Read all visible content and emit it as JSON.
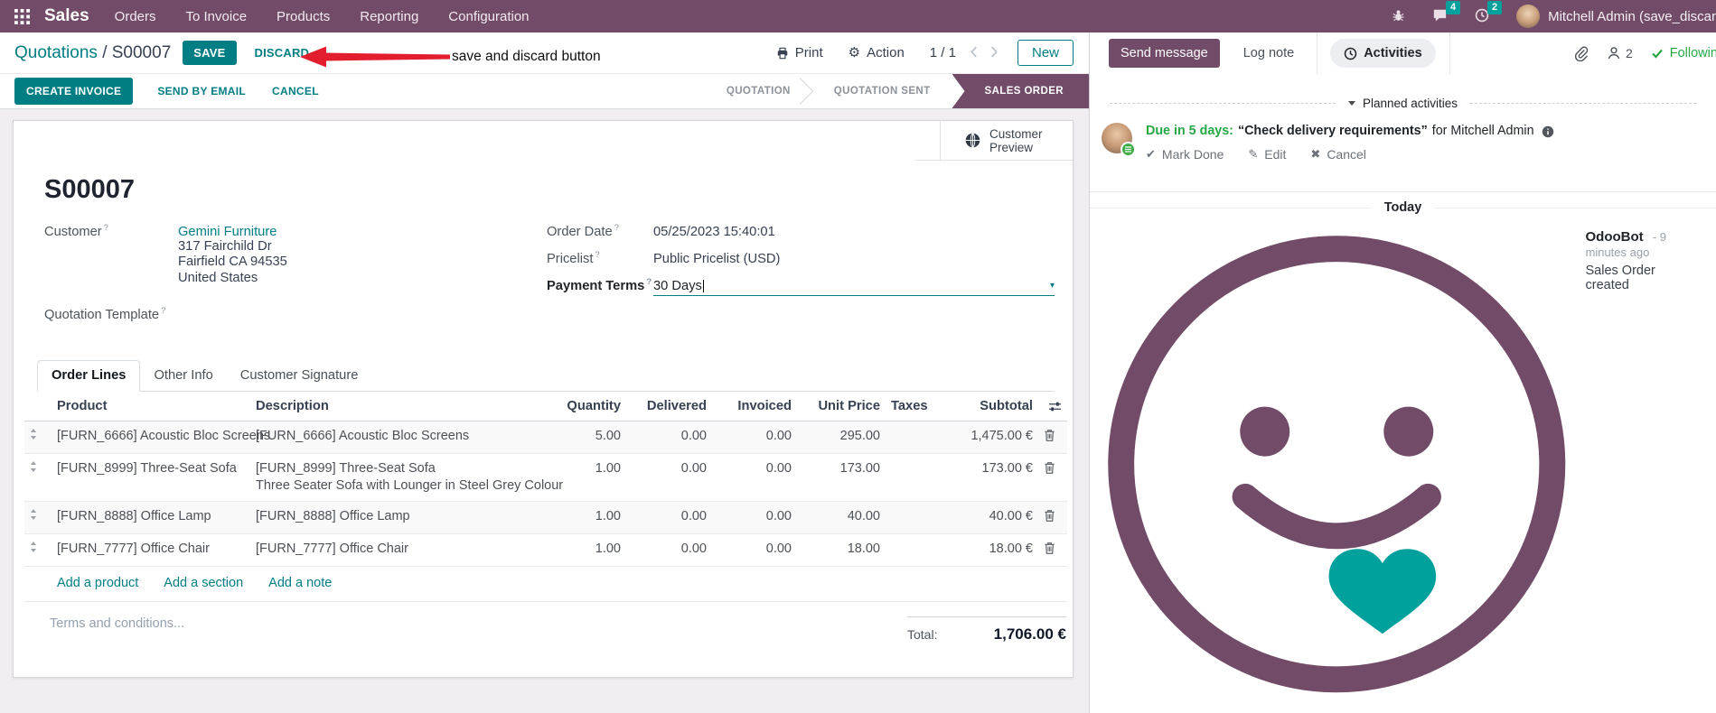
{
  "help_marker": "?",
  "topbar": {
    "app_name": "Sales",
    "menus": [
      "Orders",
      "To Invoice",
      "Products",
      "Reporting",
      "Configuration"
    ],
    "messages_badge": "4",
    "activities_badge": "2",
    "user_name": "Mitchell Admin (save_discar"
  },
  "annotation": {
    "text": "save and discard button"
  },
  "control_panel": {
    "breadcrumb_parent": "Quotations",
    "breadcrumb_separator": "/",
    "breadcrumb_current": "S00007",
    "save": "SAVE",
    "discard": "DISCARD",
    "print": "Print",
    "action": "Action",
    "pager": "1 / 1",
    "new": "New"
  },
  "status_row": {
    "create_invoice": "CREATE INVOICE",
    "send_by_email": "SEND BY EMAIL",
    "cancel": "CANCEL",
    "statuses": [
      {
        "label": "QUOTATION"
      },
      {
        "label": "QUOTATION SENT"
      },
      {
        "label": "SALES ORDER"
      }
    ]
  },
  "sheet": {
    "customer_preview": "Customer Preview",
    "title": "S00007",
    "customer_label": "Customer",
    "customer_value": "Gemini Furniture",
    "address": [
      "317 Fairchild Dr",
      "Fairfield CA 94535",
      "United States"
    ],
    "quotation_template_label": "Quotation Template",
    "order_date_label": "Order Date",
    "order_date_value": "05/25/2023 15:40:01",
    "pricelist_label": "Pricelist",
    "pricelist_value": "Public Pricelist (USD)",
    "payment_terms_label": "Payment Terms",
    "payment_terms_value": "30 Days",
    "tabs": [
      "Order Lines",
      "Other Info",
      "Customer Signature"
    ],
    "table": {
      "headers": {
        "product": "Product",
        "description": "Description",
        "quantity": "Quantity",
        "delivered": "Delivered",
        "invoiced": "Invoiced",
        "unit_price": "Unit Price",
        "taxes": "Taxes",
        "subtotal": "Subtotal"
      },
      "rows": [
        {
          "product": "[FURN_6666] Acoustic Bloc Screens",
          "desc1": "[FURN_6666] Acoustic Bloc Screens",
          "quantity": "5.00",
          "delivered": "0.00",
          "invoiced": "0.00",
          "unit_price": "295.00",
          "taxes": "",
          "subtotal": "1,475.00 €"
        },
        {
          "product": "[FURN_8999] Three-Seat Sofa",
          "desc1": "[FURN_8999] Three-Seat Sofa",
          "desc2": "Three Seater Sofa with Lounger in Steel Grey Colour",
          "quantity": "1.00",
          "delivered": "0.00",
          "invoiced": "0.00",
          "unit_price": "173.00",
          "taxes": "",
          "subtotal": "173.00 €"
        },
        {
          "product": "[FURN_8888] Office Lamp",
          "desc1": "[FURN_8888] Office Lamp",
          "quantity": "1.00",
          "delivered": "0.00",
          "invoiced": "0.00",
          "unit_price": "40.00",
          "taxes": "",
          "subtotal": "40.00 €"
        },
        {
          "product": "[FURN_7777] Office Chair",
          "desc1": "[FURN_7777] Office Chair",
          "quantity": "1.00",
          "delivered": "0.00",
          "invoiced": "0.00",
          "unit_price": "18.00",
          "taxes": "",
          "subtotal": "18.00 €"
        }
      ],
      "footer_links": [
        "Add a product",
        "Add a section",
        "Add a note"
      ]
    },
    "terms_placeholder": "Terms and conditions...",
    "total_label": "Total:",
    "total_value": "1,706.00 €"
  },
  "chatter": {
    "send_message": "Send message",
    "log_note": "Log note",
    "activities": "Activities",
    "followers_count": "2",
    "following": "Following",
    "planned_header": "Planned activities",
    "activity": {
      "due": "Due in 5 days:",
      "summary": "“Check delivery requirements”",
      "for_user": "for Mitchell Admin",
      "mark_done": "Mark Done",
      "edit": "Edit",
      "cancel": "Cancel"
    },
    "today": "Today",
    "message": {
      "author": "OdooBot",
      "time": "- 9 minutes ago",
      "body": "Sales Order created"
    }
  }
}
